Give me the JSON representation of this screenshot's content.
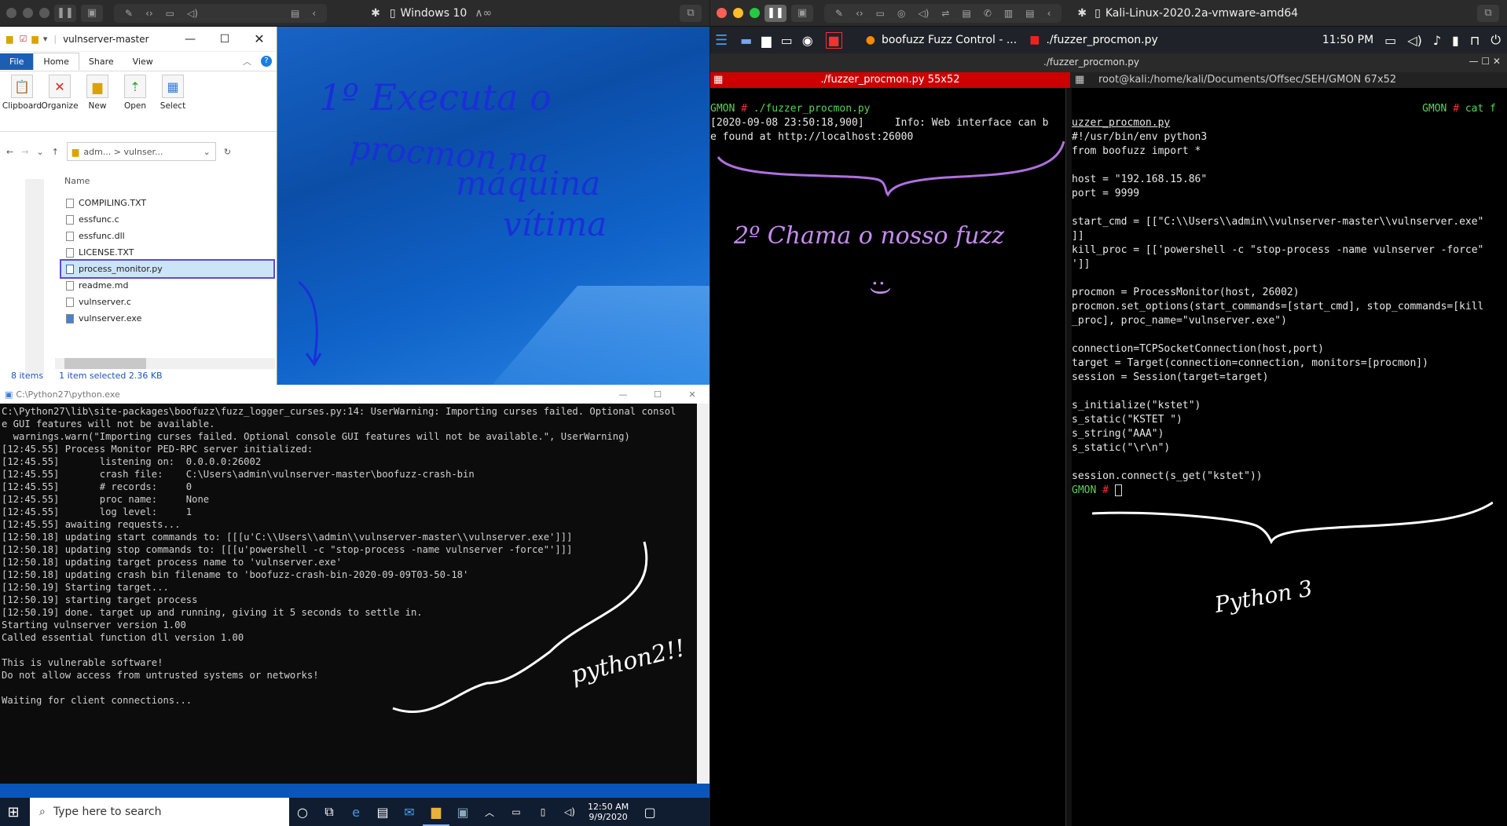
{
  "left_host_bar": {
    "title": "Windows 10"
  },
  "explorer": {
    "title": "vulnserver-master",
    "tabs": [
      "File",
      "Home",
      "Share",
      "View"
    ],
    "ribbon": [
      "Clipboard",
      "Organize",
      "New",
      "Open",
      "Select"
    ],
    "breadcrumb": "adm...  >  vulnser...",
    "column_name": "Name",
    "files": [
      "COMPILING.TXT",
      "essfunc.c",
      "essfunc.dll",
      "LICENSE.TXT",
      "process_monitor.py",
      "readme.md",
      "vulnserver.c",
      "vulnserver.exe"
    ],
    "status_items": "8 items",
    "status_selected": "1 item selected  2.36 KB"
  },
  "cmd": {
    "title": "C:\\Python27\\python.exe",
    "lines": [
      "C:\\Python27\\lib\\site-packages\\boofuzz\\fuzz_logger_curses.py:14: UserWarning: Importing curses failed. Optional consol",
      "e GUI features will not be available.",
      "  warnings.warn(\"Importing curses failed. Optional console GUI features will not be available.\", UserWarning)",
      "[12:45.55] Process Monitor PED-RPC server initialized:",
      "[12:45.55]       listening on:  0.0.0.0:26002",
      "[12:45.55]       crash file:    C:\\Users\\admin\\vulnserver-master\\boofuzz-crash-bin",
      "[12:45.55]       # records:     0",
      "[12:45.55]       proc name:     None",
      "[12:45.55]       log level:     1",
      "[12:45.55] awaiting requests...",
      "[12:50.18] updating start commands to: [[[u'C:\\\\Users\\\\admin\\\\vulnserver-master\\\\vulnserver.exe']]]",
      "[12:50.18] updating stop commands to: [[[u'powershell -c \"stop-process -name vulnserver -force\"']]]",
      "[12:50.18] updating target process name to 'vulnserver.exe'",
      "[12:50.18] updating crash bin filename to 'boofuzz-crash-bin-2020-09-09T03-50-18'",
      "[12:50.19] Starting target...",
      "[12:50.19] starting target process",
      "[12:50.19] done. target up and running, giving it 5 seconds to settle in.",
      "Starting vulnserver version 1.00",
      "Called essential function dll version 1.00",
      "",
      "This is vulnerable software!",
      "Do not allow access from untrusted systems or networks!",
      "",
      "Waiting for client connections..."
    ]
  },
  "taskbar": {
    "search": "Type here to search",
    "time": "12:50 AM",
    "date": "9/9/2020"
  },
  "right_host_bar": {
    "title": "Kali-Linux-2020.2a-vmware-amd64"
  },
  "kali": {
    "tab1": "boofuzz Fuzz Control - ...",
    "tab2": "./fuzzer_procmon.py",
    "clock": "11:50 PM",
    "terminal_title": "./fuzzer_procmon.py",
    "left_pane_head": "./fuzzer_procmon.py 55x52",
    "right_pane_head": "root@kali:/home/kali/Documents/Offsec/SEH/GMON 67x52",
    "left_prompt": "GMON",
    "left_cmd": " ./fuzzer_procmon.py",
    "left_out": [
      "[2020-09-08 23:50:18,900]     Info: Web interface can b",
      "e found at http://localhost:26000"
    ],
    "right_prompt_cmd": "cat f",
    "code": [
      "uzzer_procmon.py",
      "#!/usr/bin/env python3",
      "from boofuzz import *",
      "",
      "host = \"192.168.15.86\"",
      "port = 9999",
      "",
      "start_cmd = [[\"C:\\\\Users\\\\admin\\\\vulnserver-master\\\\vulnserver.exe\"",
      "]]",
      "kill_proc = [['powershell -c \"stop-process -name vulnserver -force\"",
      "']]",
      "",
      "procmon = ProcessMonitor(host, 26002)",
      "procmon.set_options(start_commands=[start_cmd], stop_commands=[kill",
      "_proc], proc_name=\"vulnserver.exe\")",
      "",
      "connection=TCPSocketConnection(host,port)",
      "target = Target(connection=connection, monitors=[procmon])",
      "session = Session(target=target)",
      "",
      "s_initialize(\"kstet\")",
      "s_static(\"KSTET \")",
      "s_string(\"AAA\")",
      "s_static(\"\\r\\n\")",
      "",
      "session.connect(s_get(\"kstet\"))"
    ],
    "end_prompt": "GMON"
  },
  "annotations": {
    "a1": "1º Executa o",
    "a2": "procmon na",
    "a3": "máquina",
    "a4": "vítima",
    "a5": "2º Chama o nosso fuzz",
    "a6": ":)",
    "a7": "python2!!",
    "a8": "Python 3"
  }
}
